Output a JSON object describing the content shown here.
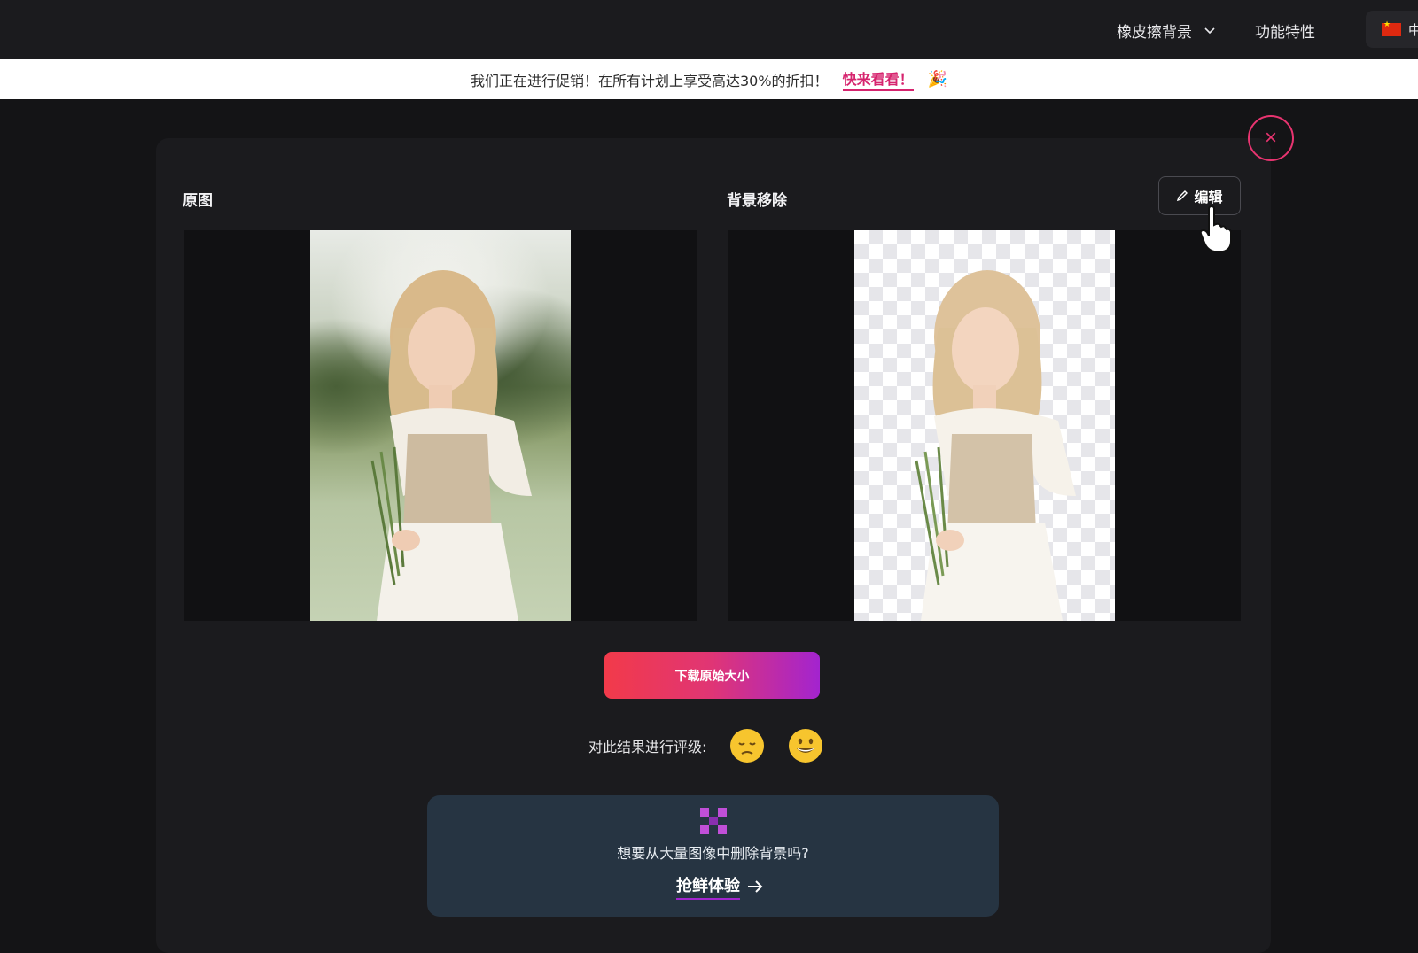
{
  "header": {
    "nav_eraser": "橡皮擦背景",
    "nav_features": "功能特性",
    "language_label": "中"
  },
  "promo": {
    "text": "我们正在进行促销！在所有计划上享受高达30%的折扣！",
    "link": "快来看看！",
    "icon": "party-popper-icon"
  },
  "panel": {
    "close_symbol": "×",
    "original_label": "原图",
    "removed_label": "背景移除",
    "edit_label": "编辑",
    "download_label": "下载原始大小",
    "rating_label": "对此结果进行评级:",
    "rating_options": [
      "sad-face-icon",
      "happy-face-icon"
    ]
  },
  "bulk": {
    "text": "想要从大量图像中删除背景吗?",
    "link": "抢鲜体验"
  },
  "colors": {
    "accent_pink": "#e83470",
    "gradient_start": "#f23a4a",
    "gradient_end": "#a324cf",
    "card_bg": "#263442"
  }
}
